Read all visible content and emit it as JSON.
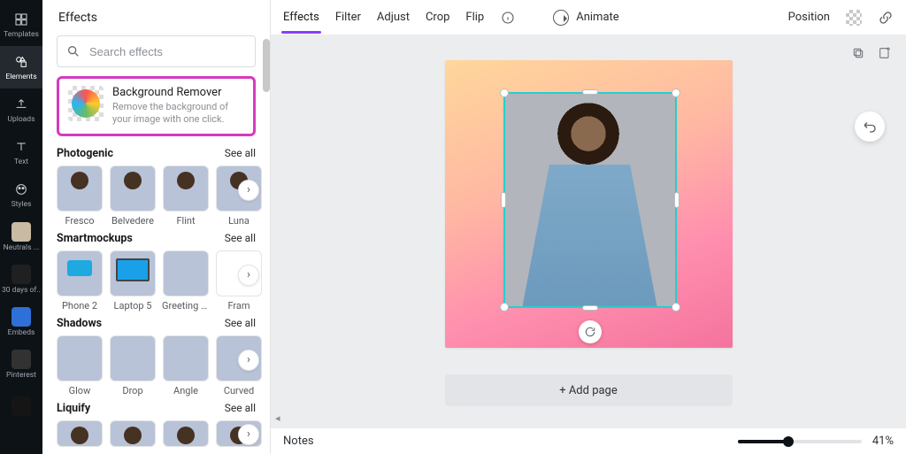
{
  "rail": {
    "items": [
      {
        "label": "Templates",
        "icon": "templates"
      },
      {
        "label": "Elements",
        "icon": "elements"
      },
      {
        "label": "Uploads",
        "icon": "uploads"
      },
      {
        "label": "Text",
        "icon": "text"
      },
      {
        "label": "Styles",
        "icon": "styles"
      },
      {
        "label": "Neutrals ...",
        "thumb": "#c9baa3"
      },
      {
        "label": "30 days of...",
        "thumb": "#222"
      },
      {
        "label": "Embeds",
        "thumb": "#2f6fd8"
      },
      {
        "label": "Pinterest",
        "thumb": "#323232"
      },
      {
        "label": "",
        "thumb": "#1a1a1a"
      }
    ],
    "active_index": 1
  },
  "panel": {
    "title": "Effects",
    "search_placeholder": "Search effects",
    "bg_remover": {
      "title": "Background Remover",
      "desc": "Remove the background of your image with one click."
    },
    "see_all": "See all",
    "sections": [
      {
        "name": "Photogenic",
        "tiles": [
          "Fresco",
          "Belvedere",
          "Flint",
          "Luna"
        ],
        "kind": "photo"
      },
      {
        "name": "Smartmockups",
        "tiles": [
          "Phone 2",
          "Laptop 5",
          "Greeting car...",
          "Fram"
        ],
        "kind": "mock"
      },
      {
        "name": "Shadows",
        "tiles": [
          "Glow",
          "Drop",
          "Angle",
          "Curved"
        ],
        "kind": "shadow"
      },
      {
        "name": "Liquify",
        "tiles": [
          "",
          "",
          "",
          ""
        ],
        "kind": "photo"
      }
    ]
  },
  "topbar": {
    "items": [
      "Effects",
      "Filter",
      "Adjust",
      "Crop",
      "Flip"
    ],
    "active_index": 0,
    "animate": "Animate",
    "position": "Position"
  },
  "stage": {
    "add_page": "+ Add page"
  },
  "bottom": {
    "notes": "Notes",
    "zoom_pct": 41,
    "zoom_label": "41%"
  }
}
